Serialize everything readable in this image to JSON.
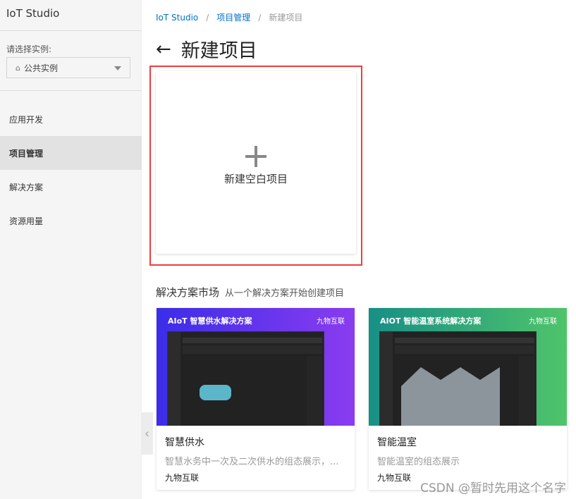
{
  "sidebar": {
    "title": "IoT Studio",
    "instance_label": "请选择实例:",
    "instance_value": "公共实例",
    "menu": [
      {
        "label": "应用开发"
      },
      {
        "label": "项目管理"
      },
      {
        "label": "解决方案"
      },
      {
        "label": "资源用量"
      }
    ]
  },
  "breadcrumb": [
    "IoT Studio",
    "项目管理",
    "新建项目"
  ],
  "page_title": "新建项目",
  "new_blank_label": "新建空白项目",
  "market": {
    "title": "解决方案市场",
    "subtitle": "从一个解决方案开始创建项目",
    "cards": [
      {
        "banner": "AIoT 智慧供水解决方案",
        "logo": "九物互联",
        "title": "智慧供水",
        "desc": "智慧水务中一次及二次供水的组态展示，...",
        "author": "九物互联",
        "gradient": [
          "#3b2de8",
          "#8a3cf0"
        ]
      },
      {
        "banner": "AIOT 智能温室系统解决方案",
        "logo": "九物互联",
        "title": "智能温室",
        "desc": "智能温室的组态展示",
        "author": "九物互联",
        "gradient": [
          "#178f86",
          "#4fc46a"
        ]
      }
    ]
  },
  "watermark": "CSDN @暂时先用这个名字"
}
